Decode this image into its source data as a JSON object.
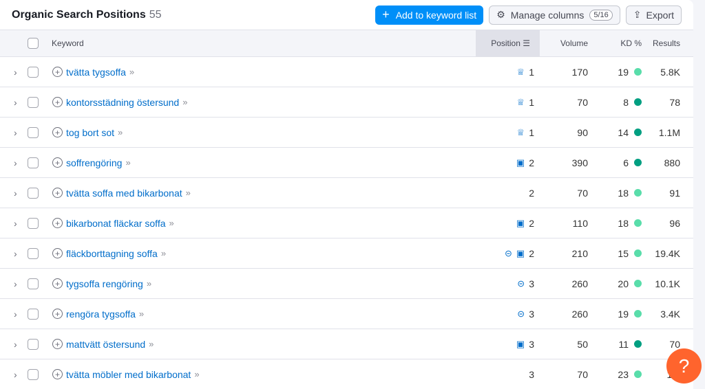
{
  "header": {
    "title": "Organic Search Positions",
    "count": "55",
    "add_button": "Add to keyword list",
    "manage_button": "Manage columns",
    "manage_badge": "5/16",
    "export_button": "Export"
  },
  "columns": {
    "keyword": "Keyword",
    "position": "Position",
    "volume": "Volume",
    "kd": "KD %",
    "results": "Results"
  },
  "colors": {
    "kd_dark": "#009f81",
    "kd_light": "#59ddaa",
    "accent": "#008ff8",
    "help": "#ff642d"
  },
  "rows": [
    {
      "keyword": "tvätta tygsoffa",
      "icons": [
        "crown-icon"
      ],
      "position": "1",
      "volume": "170",
      "kd": "19",
      "kd_level": "light",
      "results": "5.8K"
    },
    {
      "keyword": "kontorsstädning östersund",
      "icons": [
        "crown-icon"
      ],
      "position": "1",
      "volume": "70",
      "kd": "8",
      "kd_level": "dark",
      "results": "78"
    },
    {
      "keyword": "tog bort sot",
      "icons": [
        "crown-icon"
      ],
      "position": "1",
      "volume": "90",
      "kd": "14",
      "kd_level": "dark",
      "results": "1.1M"
    },
    {
      "keyword": "soffrengöring",
      "icons": [
        "image-icon"
      ],
      "position": "2",
      "volume": "390",
      "kd": "6",
      "kd_level": "dark",
      "results": "880"
    },
    {
      "keyword": "tvätta soffa med bikarbonat",
      "icons": [],
      "position": "2",
      "volume": "70",
      "kd": "18",
      "kd_level": "light",
      "results": "91"
    },
    {
      "keyword": "bikarbonat fläckar soffa",
      "icons": [
        "image-icon"
      ],
      "position": "2",
      "volume": "110",
      "kd": "18",
      "kd_level": "light",
      "results": "96"
    },
    {
      "keyword": "fläckborttagning soffa",
      "icons": [
        "link-icon",
        "image-icon"
      ],
      "position": "2",
      "volume": "210",
      "kd": "15",
      "kd_level": "light",
      "results": "19.4K"
    },
    {
      "keyword": "tygsoffa rengöring",
      "icons": [
        "link-icon"
      ],
      "position": "3",
      "volume": "260",
      "kd": "20",
      "kd_level": "light",
      "results": "10.1K"
    },
    {
      "keyword": "rengöra tygsoffa",
      "icons": [
        "link-icon"
      ],
      "position": "3",
      "volume": "260",
      "kd": "19",
      "kd_level": "light",
      "results": "3.4K"
    },
    {
      "keyword": "mattvätt östersund",
      "icons": [
        "image-icon"
      ],
      "position": "3",
      "volume": "50",
      "kd": "11",
      "kd_level": "dark",
      "results": "70"
    },
    {
      "keyword": "tvätta möbler med bikarbonat",
      "icons": [],
      "position": "3",
      "volume": "70",
      "kd": "23",
      "kd_level": "light",
      "results": "12."
    }
  ],
  "help": "?"
}
